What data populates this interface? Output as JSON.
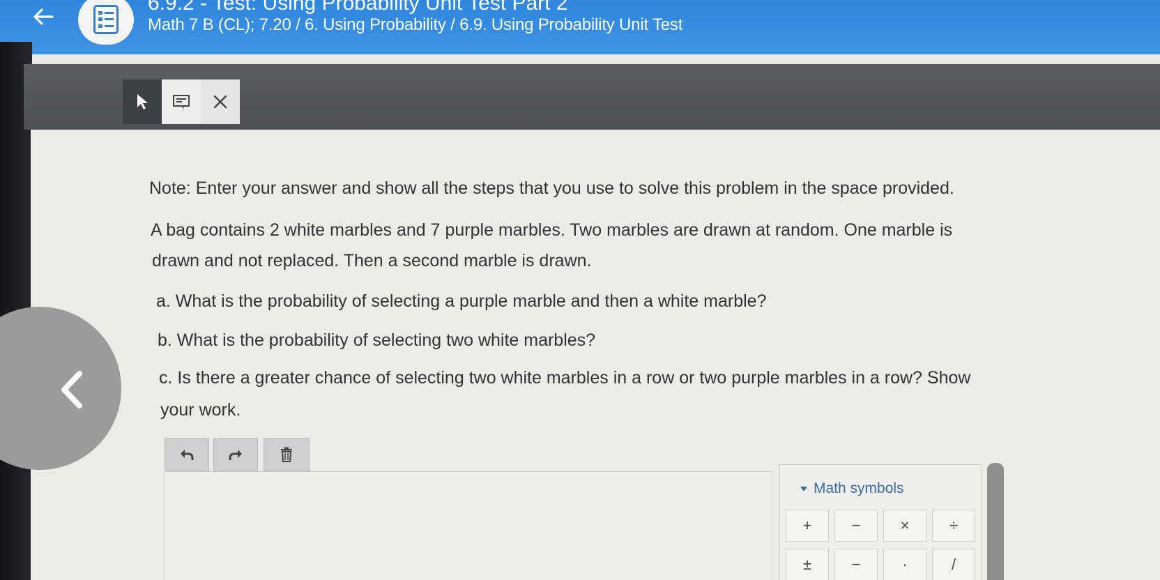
{
  "header": {
    "title": "6.9.2 - Test: Using Probability Unit Test Part 2",
    "breadcrumb": "Math 7 B (CL); 7.20 / 6. Using Probability / 6.9. Using Probability Unit Test"
  },
  "toolbar": {
    "tools": [
      "pointer-icon",
      "note-icon",
      "close-icon"
    ]
  },
  "question": {
    "note": "Note: Enter your answer and show all the steps that you use to solve this problem in the space provided.",
    "prompt_line1": "A bag contains 2 white marbles and 7 purple marbles. Two marbles are drawn at random. One marble is",
    "prompt_line2": "drawn and not replaced. Then a second marble is drawn.",
    "part_a": "a. What is the probability of selecting a purple marble and then a white marble?",
    "part_b": "b. What is the probability of selecting two white marbles?",
    "part_c_line1": "c. Is there a greater chance of selecting two white marbles in a row or two purple marbles in a row? Show",
    "part_c_line2": "your work."
  },
  "editor": {
    "buttons": [
      "undo-icon",
      "redo-icon",
      "trash-icon"
    ],
    "answer_value": ""
  },
  "math_panel": {
    "header": "Math symbols",
    "row1": [
      "+",
      "−",
      "×",
      "÷"
    ],
    "row2": [
      "±",
      "−",
      "·",
      "/"
    ]
  }
}
